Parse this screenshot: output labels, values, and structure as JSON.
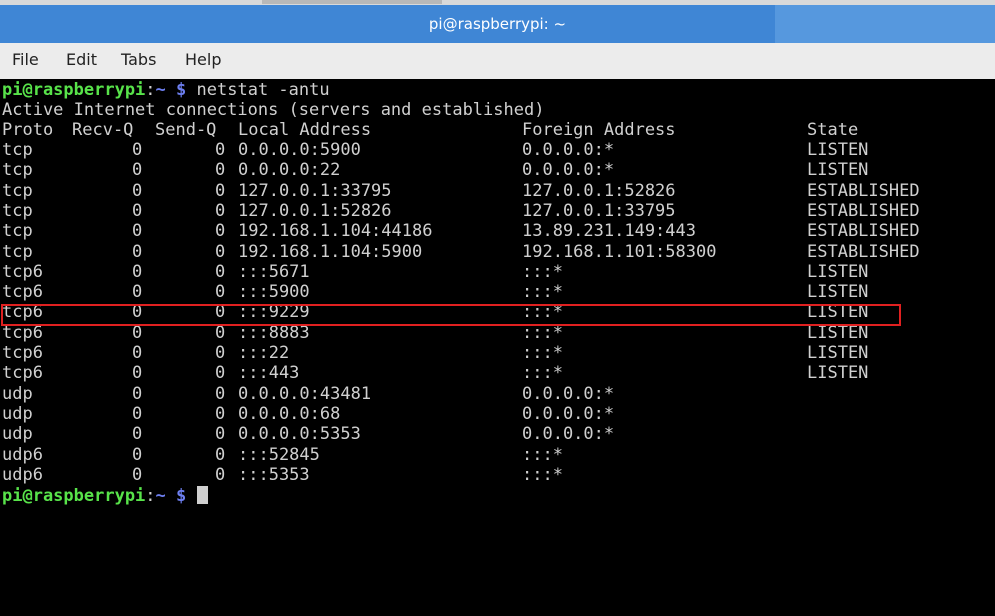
{
  "window": {
    "title": "pi@raspberrypi: ~"
  },
  "menu": [
    "File",
    "Edit",
    "Tabs",
    "Help"
  ],
  "prompt": {
    "user_host": "pi@raspberrypi",
    "sep": ":",
    "path": "~",
    "sign": "$"
  },
  "command": "netstat -antu",
  "output_header": "Active Internet connections (servers and established)",
  "columns": [
    "Proto",
    "Recv-Q",
    "Send-Q",
    "Local Address",
    "Foreign Address",
    "State"
  ],
  "rows": [
    {
      "proto": "tcp",
      "recvq": "0",
      "sendq": "0",
      "local": "0.0.0.0:5900",
      "foreign": "0.0.0.0:*",
      "state": "LISTEN"
    },
    {
      "proto": "tcp",
      "recvq": "0",
      "sendq": "0",
      "local": "0.0.0.0:22",
      "foreign": "0.0.0.0:*",
      "state": "LISTEN"
    },
    {
      "proto": "tcp",
      "recvq": "0",
      "sendq": "0",
      "local": "127.0.0.1:33795",
      "foreign": "127.0.0.1:52826",
      "state": "ESTABLISHED"
    },
    {
      "proto": "tcp",
      "recvq": "0",
      "sendq": "0",
      "local": "127.0.0.1:52826",
      "foreign": "127.0.0.1:33795",
      "state": "ESTABLISHED"
    },
    {
      "proto": "tcp",
      "recvq": "0",
      "sendq": "0",
      "local": "192.168.1.104:44186",
      "foreign": "13.89.231.149:443",
      "state": "ESTABLISHED"
    },
    {
      "proto": "tcp",
      "recvq": "0",
      "sendq": "0",
      "local": "192.168.1.104:5900",
      "foreign": "192.168.1.101:58300",
      "state": "ESTABLISHED"
    },
    {
      "proto": "tcp6",
      "recvq": "0",
      "sendq": "0",
      "local": ":::5671",
      "foreign": ":::*",
      "state": "LISTEN"
    },
    {
      "proto": "tcp6",
      "recvq": "0",
      "sendq": "0",
      "local": ":::5900",
      "foreign": ":::*",
      "state": "LISTEN"
    },
    {
      "proto": "tcp6",
      "recvq": "0",
      "sendq": "0",
      "local": ":::9229",
      "foreign": ":::*",
      "state": "LISTEN"
    },
    {
      "proto": "tcp6",
      "recvq": "0",
      "sendq": "0",
      "local": ":::8883",
      "foreign": ":::*",
      "state": "LISTEN"
    },
    {
      "proto": "tcp6",
      "recvq": "0",
      "sendq": "0",
      "local": ":::22",
      "foreign": ":::*",
      "state": "LISTEN"
    },
    {
      "proto": "tcp6",
      "recvq": "0",
      "sendq": "0",
      "local": ":::443",
      "foreign": ":::*",
      "state": "LISTEN"
    },
    {
      "proto": "udp",
      "recvq": "0",
      "sendq": "0",
      "local": "0.0.0.0:43481",
      "foreign": "0.0.0.0:*",
      "state": ""
    },
    {
      "proto": "udp",
      "recvq": "0",
      "sendq": "0",
      "local": "0.0.0.0:68",
      "foreign": "0.0.0.0:*",
      "state": ""
    },
    {
      "proto": "udp",
      "recvq": "0",
      "sendq": "0",
      "local": "0.0.0.0:5353",
      "foreign": "0.0.0.0:*",
      "state": ""
    },
    {
      "proto": "udp6",
      "recvq": "0",
      "sendq": "0",
      "local": ":::52845",
      "foreign": ":::*",
      "state": ""
    },
    {
      "proto": "udp6",
      "recvq": "0",
      "sendq": "0",
      "local": ":::5353",
      "foreign": ":::*",
      "state": ""
    }
  ],
  "colors": {
    "titlebar": "#3f86d5",
    "prompt_user": "#58e34a",
    "prompt_path": "#6d7ff0",
    "highlight": "#e02020"
  }
}
